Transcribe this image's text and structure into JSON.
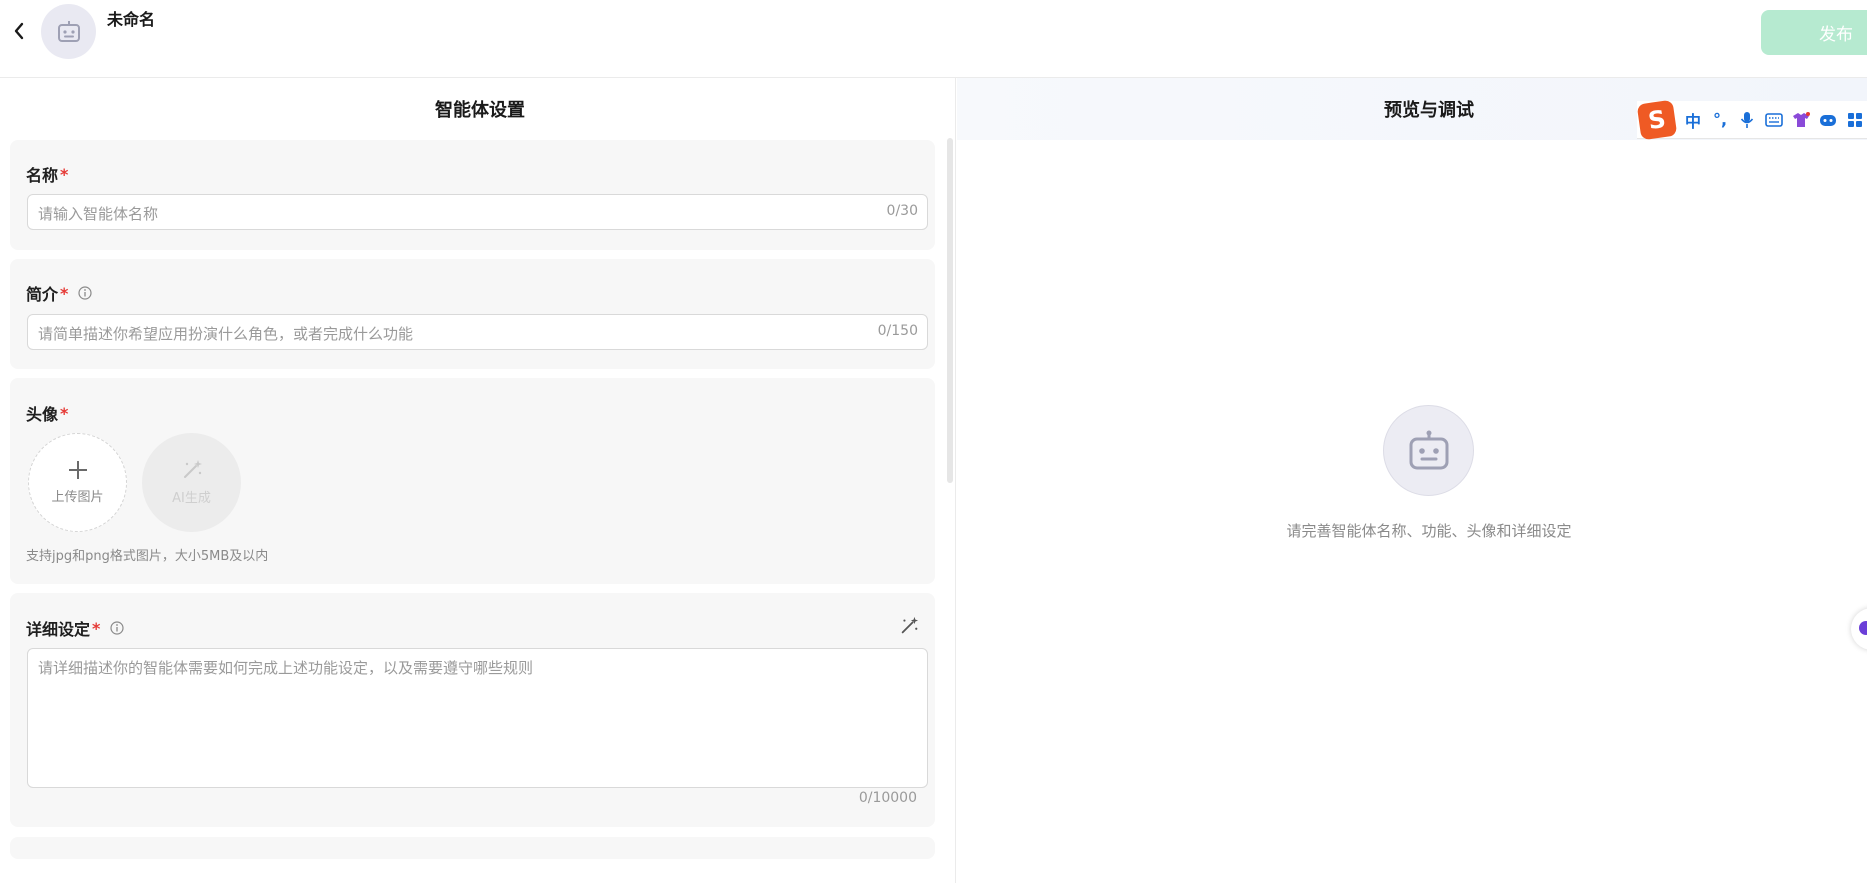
{
  "header": {
    "agent_name": "未命名",
    "publish_label": "发布"
  },
  "settings": {
    "title": "智能体设置",
    "name": {
      "label": "名称",
      "required_mark": "*",
      "placeholder": "请输入智能体名称",
      "counter": "0/30"
    },
    "intro": {
      "label": "简介",
      "required_mark": "*",
      "placeholder": "请简单描述你希望应用扮演什么角色，或者完成什么功能",
      "counter": "0/150"
    },
    "avatar": {
      "label": "头像",
      "required_mark": "*",
      "upload_label": "上传图片",
      "ai_label": "AI生成",
      "hint": "支持jpg和png格式图片，大小5MB及以内"
    },
    "detail": {
      "label": "详细设定",
      "required_mark": "*",
      "placeholder": "请详细描述你的智能体需要如何完成上述功能设定，以及需要遵守哪些规则",
      "counter": "0/10000"
    }
  },
  "preview": {
    "title": "预览与调试",
    "empty_message": "请完善智能体名称、功能、头像和详细设定"
  },
  "ime_toolbar": {
    "logo": "S",
    "mode": "中",
    "punct": "°,",
    "icons": [
      "microphone-icon",
      "keyboard-icon",
      "skin-icon",
      "emoji-icon",
      "grid-icon"
    ]
  },
  "colors": {
    "publish_bg": "#b6ead0",
    "required": "#e53935",
    "card_bg": "#f7f7f7",
    "ime_accent": "#1a6fd8",
    "ime_logo": "#ef5a24"
  }
}
